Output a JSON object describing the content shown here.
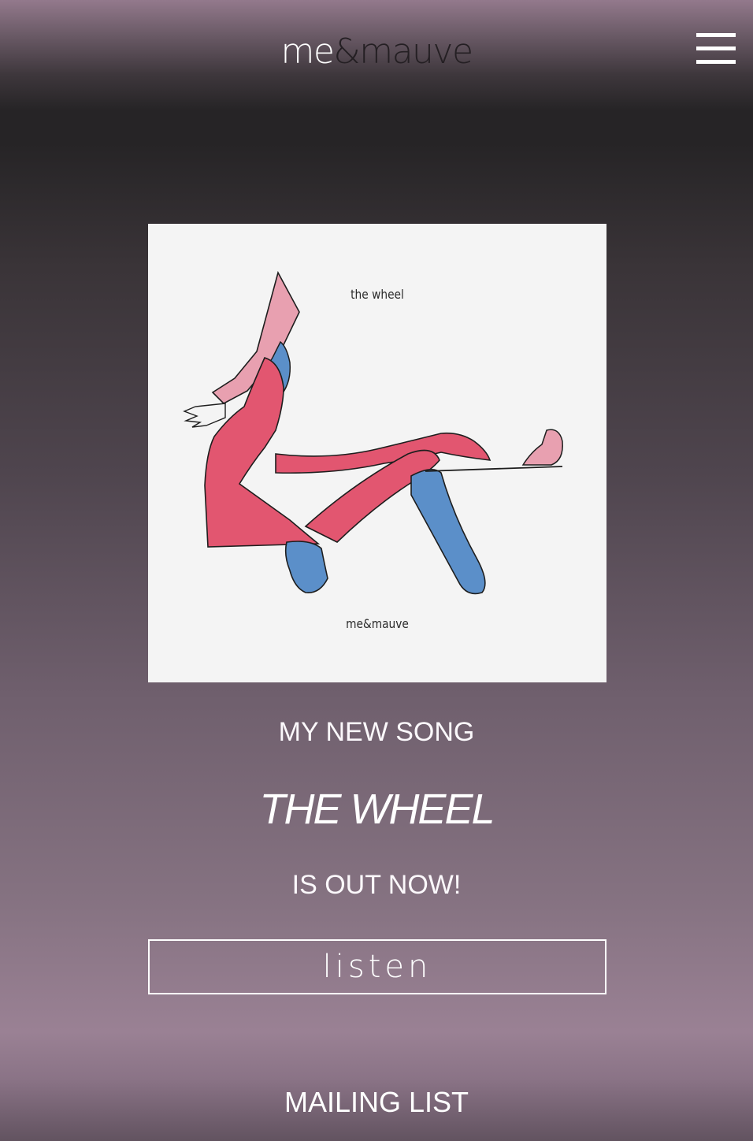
{
  "header": {
    "logo_part1": "me",
    "logo_part2": "&",
    "logo_part3": "mauve",
    "menu_icon": "hamburger-menu-icon"
  },
  "cover": {
    "title": "the wheel",
    "artist": "me&mauve"
  },
  "promo": {
    "line1": "MY NEW SONG",
    "line2": "THE WHEEL",
    "line3": "IS OUT NOW!",
    "listen_label": "listen"
  },
  "footer": {
    "mailing_label": "MAILING LIST"
  },
  "colors": {
    "mauve": "#9a8194",
    "dark": "#262426",
    "figure_pink": "#e25670",
    "figure_light_pink": "#e8a0b0",
    "figure_blue": "#5b8fc9"
  }
}
